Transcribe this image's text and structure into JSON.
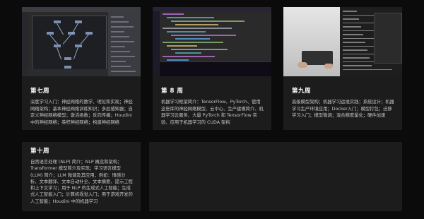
{
  "cards": [
    {
      "title": "第七周",
      "description": "深度学习入门：神经网络的数学、理论和实现；神经网络架构；基本神经网络训练知识；多层感知器；自定义神经网络模型；激活函数；反向传播；Houdini 中的神经网络；卷积神经网络；构建神经网络"
    },
    {
      "title": "第 8 周",
      "description": "机器学习框架简介：TensorFlow、PyTorch、使用这些库的神经网络模型、云中心、生产建模简介、机器学习云服务、大量 PyTorch 和 TensorFlow 实验、应用于机器学习的 CUDA 架构"
    },
    {
      "title": "第九周",
      "description": "高级模型架构；机器学习运维实践；系统设计；机器学习生产环境应用；Docker入门；模型打包；迁移学习入门；模型微调；混合精度量化；硬件加速"
    },
    {
      "title": "第十周",
      "description": "自然语言处理 (NLP) 简介；NLP 概念和架构；Transformer 模型简介及实现；学习语言模型 (LLM) 简介；LLM 微调及其应用，例如：情感分析、文本翻译、文本自动补全、文本摘要、提示工程和上下文学习；用于 NLP 的生成式人工智能；生成式人工智能入门；计算机视觉入门；用于游戏开发的人工智能；Houdini 中的机器学习"
    }
  ],
  "colors": {
    "background": "#0b0b0b",
    "card": "#1c1c1c",
    "title": "#ffffff",
    "text": "#c4c4c4"
  }
}
